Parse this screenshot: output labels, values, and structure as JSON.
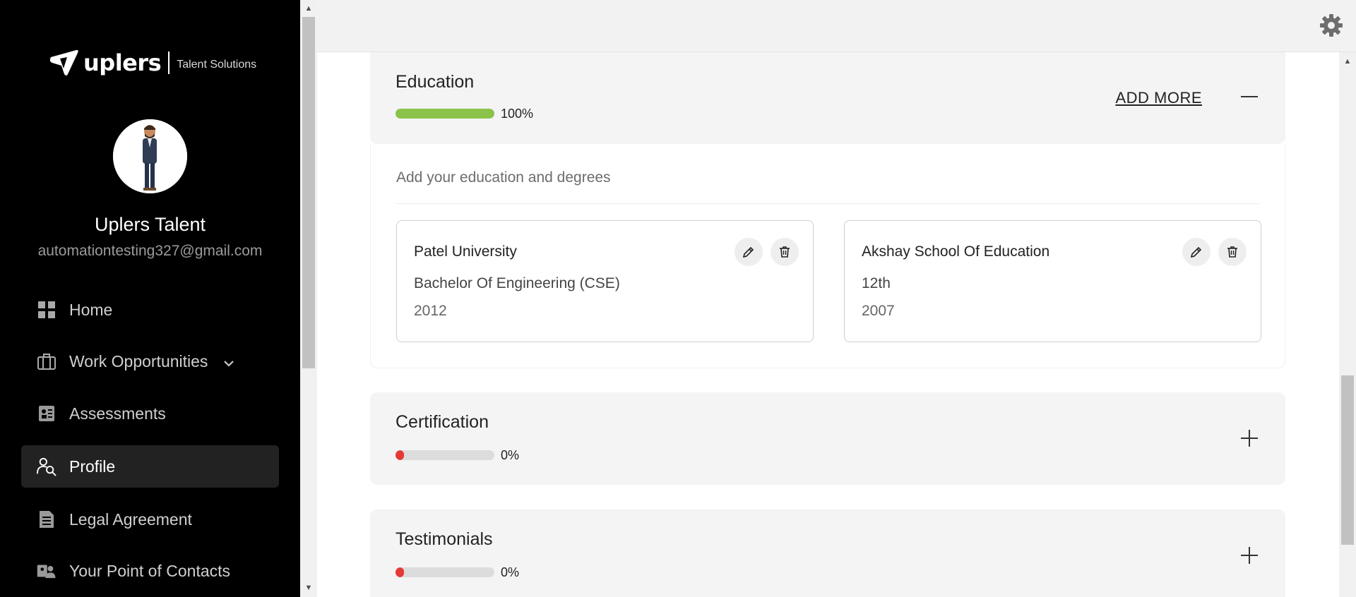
{
  "brand": {
    "name": "uplers",
    "tagline": "Talent Solutions"
  },
  "user": {
    "name": "Uplers Talent",
    "email": "automationtesting327@gmail.com"
  },
  "nav": [
    {
      "label": "Home",
      "icon": "grid-icon",
      "active": false
    },
    {
      "label": "Work Opportunities",
      "icon": "briefcase-icon",
      "active": false,
      "expandable": true
    },
    {
      "label": "Assessments",
      "icon": "assessment-icon",
      "active": false
    },
    {
      "label": "Profile",
      "icon": "profile-search-icon",
      "active": true
    },
    {
      "label": "Legal Agreement",
      "icon": "document-icon",
      "active": false
    },
    {
      "label": "Your Point of Contacts",
      "icon": "contacts-icon",
      "active": false
    }
  ],
  "education": {
    "title": "Education",
    "progress": 100,
    "progress_label": "100%",
    "progress_color": "#8bc34a",
    "add_more": "ADD MORE",
    "description": "Add your education and degrees",
    "entries": [
      {
        "institution": "Patel University",
        "degree": "Bachelor Of Engineering (CSE)",
        "year": "2012"
      },
      {
        "institution": "Akshay School Of Education",
        "degree": "12th",
        "year": "2007"
      }
    ]
  },
  "certification": {
    "title": "Certification",
    "progress": 0,
    "progress_label": "0%",
    "progress_color": "#e53935"
  },
  "testimonials": {
    "title": "Testimonials",
    "progress": 0,
    "progress_label": "0%",
    "progress_color": "#e53935"
  }
}
